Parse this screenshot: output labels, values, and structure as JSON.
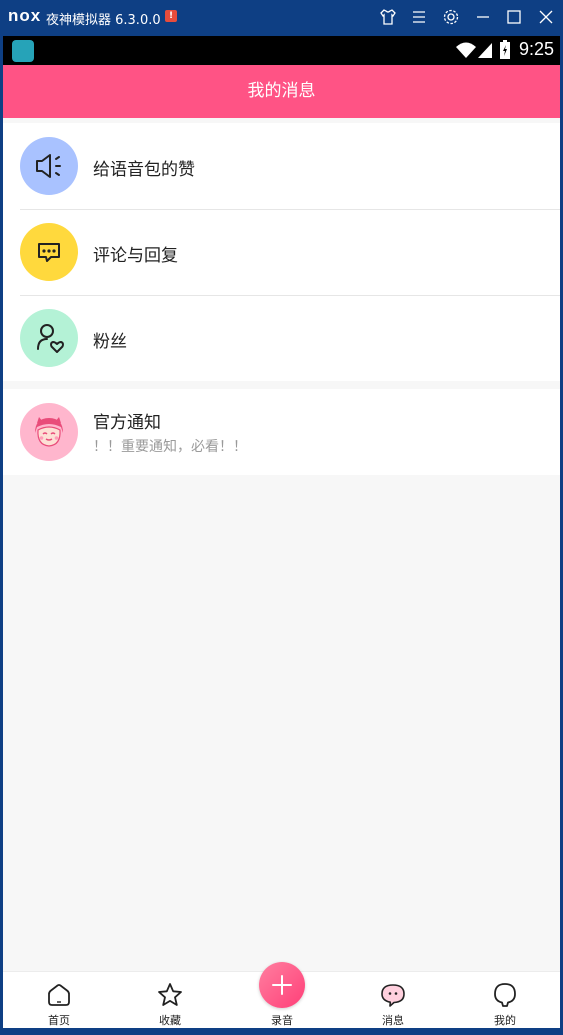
{
  "emulator": {
    "logo": "nox",
    "title": "夜神模拟器 6.3.0.0",
    "alert_badge": "!"
  },
  "statusbar": {
    "time": "9:25"
  },
  "appbar": {
    "title": "我的消息"
  },
  "messages": [
    {
      "title": "给语音包的赞",
      "icon": "megaphone-icon",
      "color": "#a9c2ff"
    },
    {
      "title": "评论与回复",
      "icon": "comment-icon",
      "color": "#ffd93d"
    },
    {
      "title": "粉丝",
      "icon": "fan-icon",
      "color": "#b4f2d6"
    }
  ],
  "official": {
    "title": "官方通知",
    "subtitle": "！！重要通知，必看！！",
    "icon": "girl-avatar-icon",
    "color": "#ffb6cd"
  },
  "bottom_nav": [
    {
      "label": "首页",
      "icon": "home-icon"
    },
    {
      "label": "收藏",
      "icon": "star-icon"
    },
    {
      "label": "录音",
      "icon": "plus-icon"
    },
    {
      "label": "消息",
      "icon": "chat-icon"
    },
    {
      "label": "我的",
      "icon": "profile-icon"
    }
  ],
  "colors": {
    "accent": "#ff5385",
    "emulator_frame": "#0e3f84",
    "background": "#f7f7f7"
  }
}
